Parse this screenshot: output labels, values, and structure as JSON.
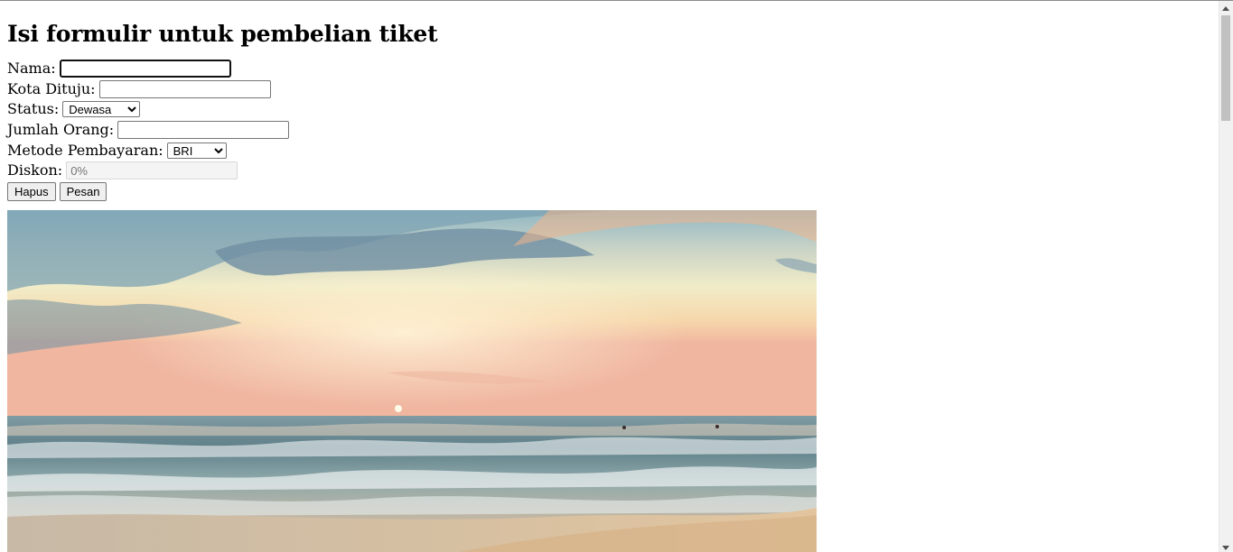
{
  "page": {
    "heading": "Isi formulir untuk pembelian tiket"
  },
  "form": {
    "nama_label": "Nama:",
    "nama_value": "",
    "kota_label": "Kota Dituju:",
    "kota_value": "",
    "status_label": "Status:",
    "status_selected": "Dewasa",
    "jumlah_label": "Jumlah Orang:",
    "jumlah_value": "",
    "metode_label": "Metode Pembayaran:",
    "metode_selected": "BRI",
    "diskon_label": "Diskon:",
    "diskon_placeholder": "0%"
  },
  "buttons": {
    "hapus": "Hapus",
    "pesan": "Pesan"
  },
  "image": {
    "subject": "beach-sunset"
  }
}
